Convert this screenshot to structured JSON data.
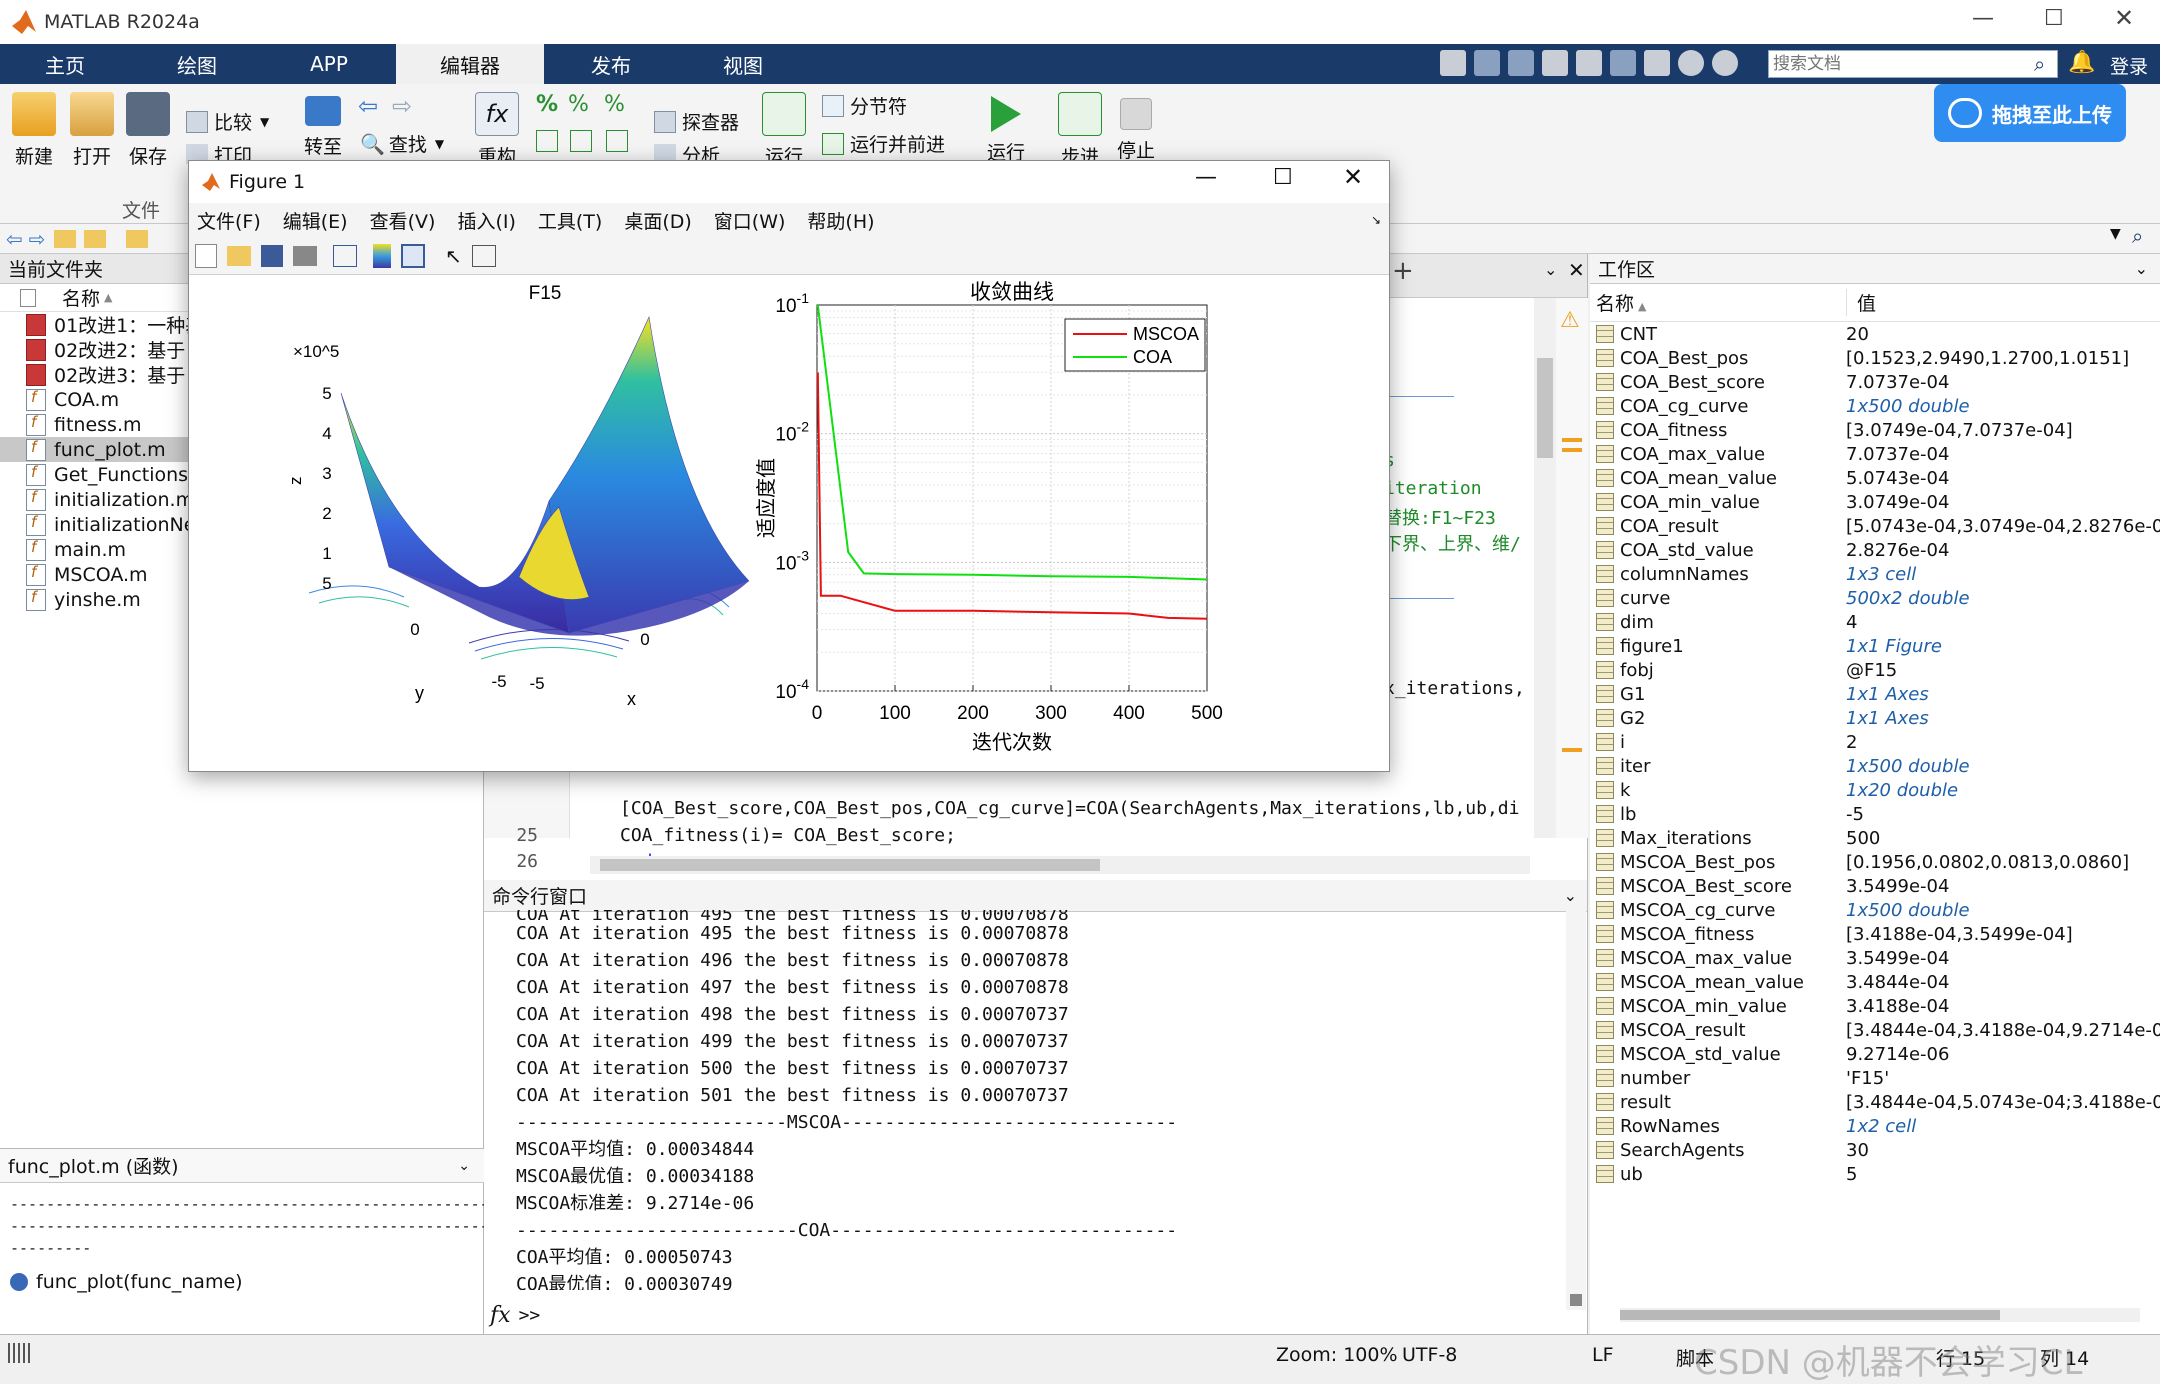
{
  "app": {
    "title": "MATLAB R2024a"
  },
  "tabs": [
    "主页",
    "绘图",
    "APP",
    "编辑器",
    "发布",
    "视图"
  ],
  "search": {
    "placeholder": "搜索文档"
  },
  "login": "登录",
  "upload_button": "拖拽至此上传",
  "ribbon": {
    "new": "新建",
    "open": "打开",
    "save": "保存",
    "compare": "比较",
    "print": "打印",
    "goto": "转至",
    "find": "查找",
    "refactor": "重构",
    "explorer": "探查器",
    "analyze": "分析",
    "run_section": "运行节",
    "section_break": "分节符",
    "run_advance": "运行并前进",
    "run": "运行",
    "step": "步进",
    "stop": "停止",
    "file_group": "文件"
  },
  "left_panel": {
    "header": "当前文件夹",
    "column": "名称",
    "files": [
      {
        "name": "01改进1：一种基",
        "type": "pdf"
      },
      {
        "name": "02改进2：基于",
        "type": "pdf"
      },
      {
        "name": "02改进3：基于",
        "type": "pdf"
      },
      {
        "name": "COA.m",
        "type": "m"
      },
      {
        "name": "fitness.m",
        "type": "m"
      },
      {
        "name": "func_plot.m",
        "type": "m",
        "selected": true
      },
      {
        "name": "Get_Functions_",
        "type": "m"
      },
      {
        "name": "initialization.m",
        "type": "m"
      },
      {
        "name": "initializationNe",
        "type": "m"
      },
      {
        "name": "main.m",
        "type": "m"
      },
      {
        "name": "MSCOA.m",
        "type": "m"
      },
      {
        "name": "yinshe.m",
        "type": "m"
      }
    ],
    "detail_title": "func_plot.m  (函数)",
    "detail_dash1": "------------------------------------------------------",
    "detail_dash2": "------------------------------------------------------",
    "detail_dash3": "---------",
    "detail_sig": "func_plot(func_name)"
  },
  "editor": {
    "frag1": "s",
    "frag2": "iteration",
    "frag3": "替换:F1~F23",
    "frag4": "下界、上界、维/",
    "frag5": "x_iterations,",
    "line24": "[COA_Best_score,COA_Best_pos,COA_cg_curve]=COA(SearchAgents,Max_iterations,lb,ub,di",
    "lines": [
      {
        "num": "25",
        "code": "COA_fitness(i)= COA_Best_score;",
        "kind": "code"
      },
      {
        "num": "26",
        "code": "end",
        "kind": "kw"
      },
      {
        "num": "27",
        "code": "",
        "kind": "code"
      }
    ]
  },
  "command_window": {
    "header": "命令行窗口",
    "lines": [
      "COA At iteration 495 the best fitness is 0.00070878",
      "COA At iteration 496 the best fitness is 0.00070878",
      "COA At iteration 497 the best fitness is 0.00070878",
      "COA At iteration 498 the best fitness is 0.00070737",
      "COA At iteration 499 the best fitness is 0.00070737",
      "COA At iteration 500 the best fitness is 0.00070737",
      "COA At iteration 501 the best fitness is 0.00070737",
      "-------------------------MSCOA-------------------------------",
      "MSCOA平均值: 0.00034844",
      "MSCOA最优值: 0.00034188",
      "MSCOA标准差: 9.2714e-06",
      "--------------------------COA--------------------------------",
      "COA平均值: 0.00050743",
      "COA最优值: 0.00030749",
      "COA标准差: 0.00028276"
    ],
    "prompt": ">>"
  },
  "workspace": {
    "header": "工作区",
    "col_name": "名称",
    "col_value": "值",
    "vars": [
      {
        "name": "CNT",
        "value": "20",
        "link": false
      },
      {
        "name": "COA_Best_pos",
        "value": "[0.1523,2.9490,1.2700,1.0151]",
        "link": false
      },
      {
        "name": "COA_Best_score",
        "value": "7.0737e-04",
        "link": false
      },
      {
        "name": "COA_cg_curve",
        "value": "1x500 double",
        "link": true
      },
      {
        "name": "COA_fitness",
        "value": "[3.0749e-04,7.0737e-04]",
        "link": false
      },
      {
        "name": "COA_max_value",
        "value": "7.0737e-04",
        "link": false
      },
      {
        "name": "COA_mean_value",
        "value": "5.0743e-04",
        "link": false
      },
      {
        "name": "COA_min_value",
        "value": "3.0749e-04",
        "link": false
      },
      {
        "name": "COA_result",
        "value": "[5.0743e-04,3.0749e-04,2.8276e-04",
        "link": false
      },
      {
        "name": "COA_std_value",
        "value": "2.8276e-04",
        "link": false
      },
      {
        "name": "columnNames",
        "value": "1x3 cell",
        "link": true
      },
      {
        "name": "curve",
        "value": "500x2 double",
        "link": true
      },
      {
        "name": "dim",
        "value": "4",
        "link": false
      },
      {
        "name": "figure1",
        "value": "1x1 Figure",
        "link": true
      },
      {
        "name": "fobj",
        "value": "@F15",
        "link": false
      },
      {
        "name": "G1",
        "value": "1x1 Axes",
        "link": true
      },
      {
        "name": "G2",
        "value": "1x1 Axes",
        "link": true
      },
      {
        "name": "i",
        "value": "2",
        "link": false
      },
      {
        "name": "iter",
        "value": "1x500 double",
        "link": true
      },
      {
        "name": "k",
        "value": "1x20 double",
        "link": true
      },
      {
        "name": "lb",
        "value": "-5",
        "link": false
      },
      {
        "name": "Max_iterations",
        "value": "500",
        "link": false
      },
      {
        "name": "MSCOA_Best_pos",
        "value": "[0.1956,0.0802,0.0813,0.0860]",
        "link": false
      },
      {
        "name": "MSCOA_Best_score",
        "value": "3.5499e-04",
        "link": false
      },
      {
        "name": "MSCOA_cg_curve",
        "value": "1x500 double",
        "link": true
      },
      {
        "name": "MSCOA_fitness",
        "value": "[3.4188e-04,3.5499e-04]",
        "link": false
      },
      {
        "name": "MSCOA_max_value",
        "value": "3.5499e-04",
        "link": false
      },
      {
        "name": "MSCOA_mean_value",
        "value": "3.4844e-04",
        "link": false
      },
      {
        "name": "MSCOA_min_value",
        "value": "3.4188e-04",
        "link": false
      },
      {
        "name": "MSCOA_result",
        "value": "[3.4844e-04,3.4188e-04,9.2714e-06",
        "link": false
      },
      {
        "name": "MSCOA_std_value",
        "value": "9.2714e-06",
        "link": false
      },
      {
        "name": "number",
        "value": "'F15'",
        "link": false
      },
      {
        "name": "result",
        "value": "[3.4844e-04,5.0743e-04;3.4188e-04",
        "link": false
      },
      {
        "name": "RowNames",
        "value": "1x2 cell",
        "link": true
      },
      {
        "name": "SearchAgents",
        "value": "30",
        "link": false
      },
      {
        "name": "ub",
        "value": "5",
        "link": false
      }
    ]
  },
  "status_bar": {
    "zoom": "Zoom: 100%",
    "encoding": "UTF-8",
    "eol": "LF",
    "mode": "脚本",
    "line": "行 15",
    "col": "列 14",
    "watermark": "CSDN @机器不会学习CL"
  },
  "figure": {
    "title": "Figure 1",
    "menu": [
      "文件(F)",
      "编辑(E)",
      "查看(V)",
      "插入(I)",
      "工具(T)",
      "桌面(D)",
      "窗口(W)",
      "帮助(H)"
    ]
  },
  "chart_data": [
    {
      "type": "surface",
      "title": "F15",
      "zlabel": "z",
      "xlabel": "x",
      "ylabel": "y",
      "z_exponent": "×10^5",
      "z_ticks": [
        "1",
        "2",
        "3",
        "4",
        "5"
      ],
      "x_ticks": [
        "-5",
        "0",
        "5"
      ],
      "y_ticks": [
        "-5",
        "0",
        "5"
      ]
    },
    {
      "type": "line",
      "title": "收敛曲线",
      "xlabel": "迭代次数",
      "ylabel": "适应度值",
      "yscale": "log",
      "xlim": [
        0,
        500
      ],
      "ylim": [
        0.0001,
        0.1
      ],
      "x_ticks": [
        "0",
        "100",
        "200",
        "300",
        "400",
        "500"
      ],
      "y_ticks": [
        "10^-1",
        "10^-2",
        "10^-3",
        "10^-4"
      ],
      "grid": true,
      "legend_position": "top-right",
      "series": [
        {
          "name": "MSCOA",
          "color": "#e81010",
          "x": [
            1,
            5,
            30,
            100,
            200,
            300,
            400,
            450,
            500
          ],
          "y": [
            0.03,
            0.00055,
            0.00055,
            0.00042,
            0.00042,
            0.00041,
            0.0004,
            0.00037,
            0.000365
          ]
        },
        {
          "name": "COA",
          "color": "#10e010",
          "x": [
            1,
            40,
            60,
            100,
            200,
            300,
            400,
            500
          ],
          "y": [
            0.1,
            0.0012,
            0.00082,
            0.00081,
            0.0008,
            0.00078,
            0.00077,
            0.000735
          ]
        }
      ]
    }
  ]
}
